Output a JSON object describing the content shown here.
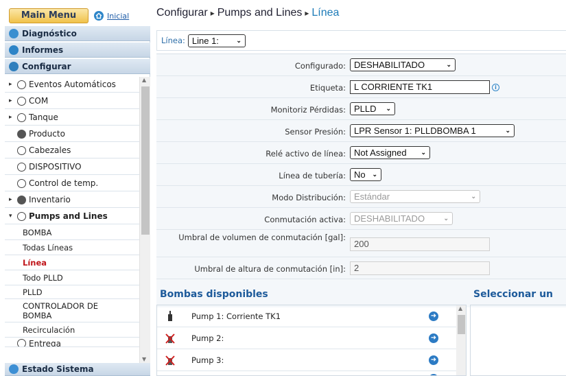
{
  "topbar": {
    "main_menu": "Main Menu",
    "home_link": "Inicial",
    "breadcrumb": [
      "Configurar",
      "Pumps and Lines",
      "Línea"
    ]
  },
  "sidebar": {
    "headers": [
      "Diagnóstico",
      "Informes",
      "Configurar"
    ],
    "items": [
      {
        "label": "Eventos Automáticos",
        "expandable": true,
        "icon": "gear-icon"
      },
      {
        "label": "COM",
        "expandable": true,
        "icon": "com-icon"
      },
      {
        "label": "Tanque",
        "expandable": true,
        "icon": "tank-icon"
      },
      {
        "label": "Producto",
        "expandable": false,
        "icon": "product-icon"
      },
      {
        "label": "Cabezales",
        "expandable": false,
        "icon": "head-icon"
      },
      {
        "label": "DISPOSITIVO",
        "expandable": false,
        "icon": "device-icon"
      },
      {
        "label": "Control de temp.",
        "expandable": false,
        "icon": "temperature-icon"
      },
      {
        "label": "Inventario",
        "expandable": true,
        "icon": "inventory-icon"
      },
      {
        "label": "Pumps and Lines",
        "expandable": true,
        "icon": "pump-icon",
        "expanded": true
      }
    ],
    "subitems": [
      "BOMBA",
      "Todas Líneas",
      "Línea",
      "Todo PLLD",
      "PLLD",
      "CONTROLADOR DE BOMBA",
      "Recirculación"
    ],
    "active_subitem": "Línea",
    "partial_item": "Entrega",
    "footer": "Estado Sistema"
  },
  "line_select": {
    "label": "Línea:",
    "value": "Line 1:"
  },
  "form": [
    {
      "label": "Configurado:",
      "type": "select",
      "value": "DESHABILITADO",
      "disabled": false
    },
    {
      "label": "Etiqueta:",
      "type": "text",
      "value": "L CORRIENTE TK1",
      "disabled": false
    },
    {
      "label": "Monitoriz Pérdidas:",
      "type": "select",
      "value": "PLLD",
      "disabled": false
    },
    {
      "label": "Sensor Presión:",
      "type": "select",
      "value": "LPR Sensor 1: PLLDBOMBA 1",
      "disabled": false
    },
    {
      "label": "Relé activo de línea:",
      "type": "select",
      "value": "Not Assigned",
      "disabled": false
    },
    {
      "label": "Línea de tubería:",
      "type": "select",
      "value": "No",
      "disabled": false
    },
    {
      "label": "Modo Distribución:",
      "type": "select",
      "value": "Estándar",
      "disabled": true
    },
    {
      "label": "Conmutación activa:",
      "type": "select",
      "value": "DESHABILITADO",
      "disabled": true
    },
    {
      "label": "Umbral de volumen de conmutación [gal]:",
      "type": "text",
      "value": "200",
      "disabled": true
    },
    {
      "label": "Umbral de altura de conmutación [in]:",
      "type": "text",
      "value": "2",
      "disabled": true
    }
  ],
  "bombas": {
    "title": "Bombas disponibles",
    "select_title": "Seleccionar un",
    "pumps": [
      {
        "name": "Pump 1: Corriente TK1",
        "status": "ok"
      },
      {
        "name": "Pump 2:",
        "status": "not-configured"
      },
      {
        "name": "Pump 3:",
        "status": "not-configured"
      }
    ]
  }
}
